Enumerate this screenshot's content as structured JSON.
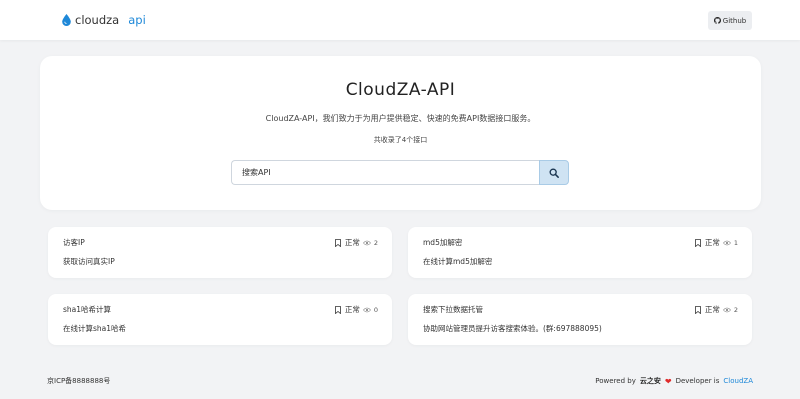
{
  "header": {
    "brand_name": "cloudza",
    "brand_sub": "api",
    "github_label": "Github"
  },
  "hero": {
    "title": "CloudZA-API",
    "description": "CloudZA-API，我们致力于为用户提供稳定、快速的免费API数据接口服务。",
    "count_text": "共收录了4个接口",
    "search_placeholder": "搜索API"
  },
  "cards": [
    {
      "title": "访客IP",
      "status": "正常",
      "views": "2",
      "desc": "获取访问真实IP"
    },
    {
      "title": "md5加解密",
      "status": "正常",
      "views": "1",
      "desc": "在线计算md5加解密"
    },
    {
      "title": "sha1哈希计算",
      "status": "正常",
      "views": "0",
      "desc": "在线计算sha1哈希"
    },
    {
      "title": "搜索下拉数据托管",
      "status": "正常",
      "views": "2",
      "desc": "协助网站管理员提升访客搜索体验。(群:697888095)"
    }
  ],
  "footer": {
    "icp": "京ICP备8888888号",
    "powered_by": "Powered by",
    "powered_name": "云之安",
    "developer_label": "Developer is",
    "developer_name": "CloudZA"
  },
  "colors": {
    "accent": "#1e88d8",
    "heart": "#e02b2b",
    "background": "#f2f3f5",
    "search_button": "#cfe3f3"
  }
}
